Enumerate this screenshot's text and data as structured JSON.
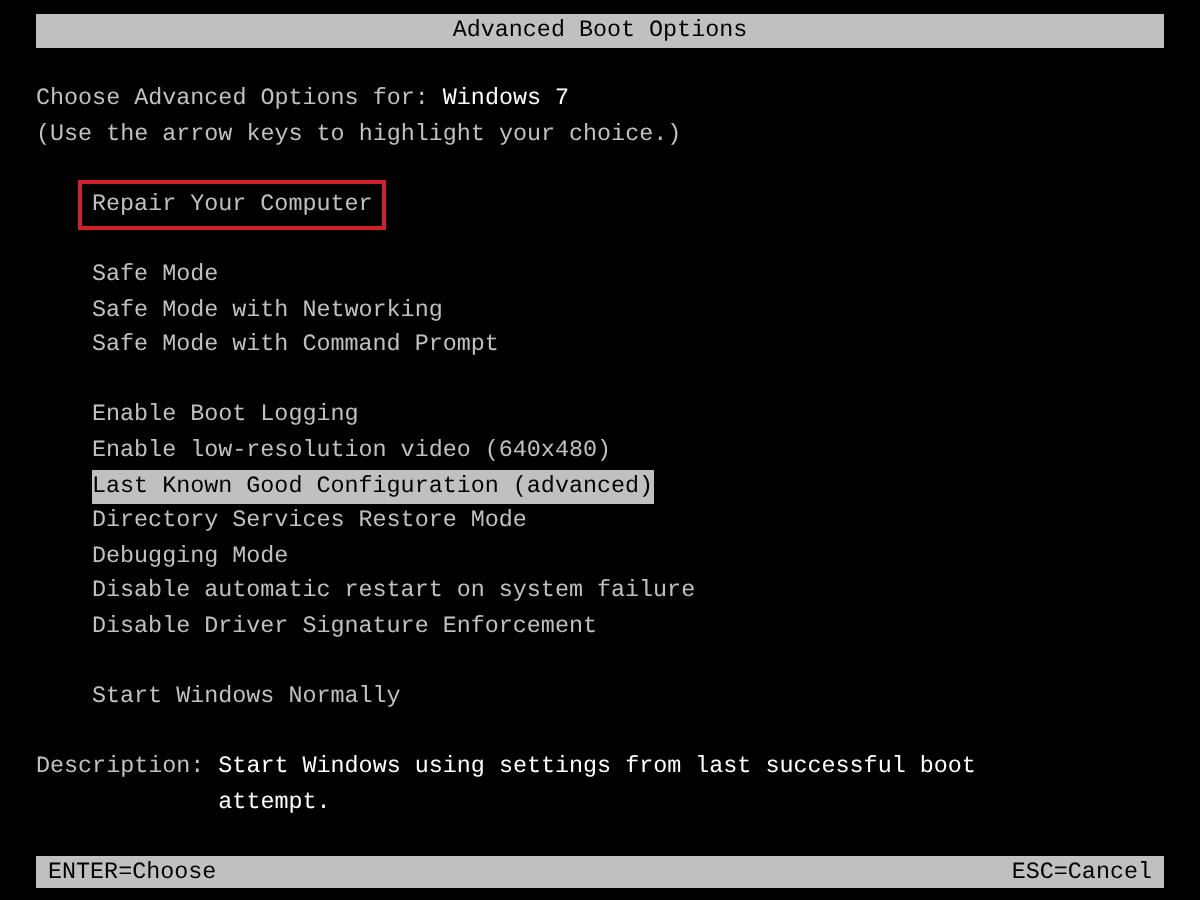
{
  "title": "Advanced Boot Options",
  "header": {
    "label": "Choose Advanced Options for: ",
    "os": "Windows 7",
    "hint": "(Use the arrow keys to highlight your choice.)"
  },
  "groups": [
    [
      {
        "label": "Repair Your Computer",
        "selected": false,
        "outlined": true
      }
    ],
    [
      {
        "label": "Safe Mode",
        "selected": false,
        "outlined": false
      },
      {
        "label": "Safe Mode with Networking",
        "selected": false,
        "outlined": false
      },
      {
        "label": "Safe Mode with Command Prompt",
        "selected": false,
        "outlined": false
      }
    ],
    [
      {
        "label": "Enable Boot Logging",
        "selected": false,
        "outlined": false
      },
      {
        "label": "Enable low-resolution video (640x480)",
        "selected": false,
        "outlined": false
      },
      {
        "label": "Last Known Good Configuration (advanced)",
        "selected": true,
        "outlined": false
      },
      {
        "label": "Directory Services Restore Mode",
        "selected": false,
        "outlined": false
      },
      {
        "label": "Debugging Mode",
        "selected": false,
        "outlined": false
      },
      {
        "label": "Disable automatic restart on system failure",
        "selected": false,
        "outlined": false
      },
      {
        "label": "Disable Driver Signature Enforcement",
        "selected": false,
        "outlined": false
      }
    ],
    [
      {
        "label": "Start Windows Normally",
        "selected": false,
        "outlined": false
      }
    ]
  ],
  "description": {
    "label": "Description:",
    "lines": [
      "Start Windows using settings from last successful boot",
      "attempt."
    ]
  },
  "footer": {
    "left": "ENTER=Choose",
    "right": "ESC=Cancel"
  }
}
